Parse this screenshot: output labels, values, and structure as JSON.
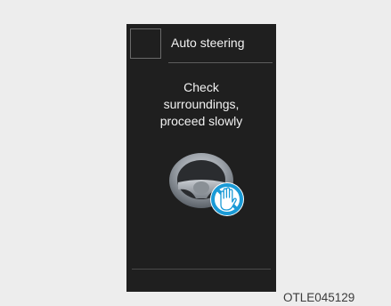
{
  "display": {
    "title": "Auto steering",
    "message_lines": [
      "Check",
      "surroundings,",
      "proceed slowly"
    ],
    "icon": "steering-wheel-hands-off-icon"
  },
  "caption": "OTLE045129",
  "colors": {
    "screen_bg": "#1f1f1f",
    "page_bg": "#ededed",
    "text": "#f2f2f2",
    "warning_blue": "#1a9ad6"
  }
}
